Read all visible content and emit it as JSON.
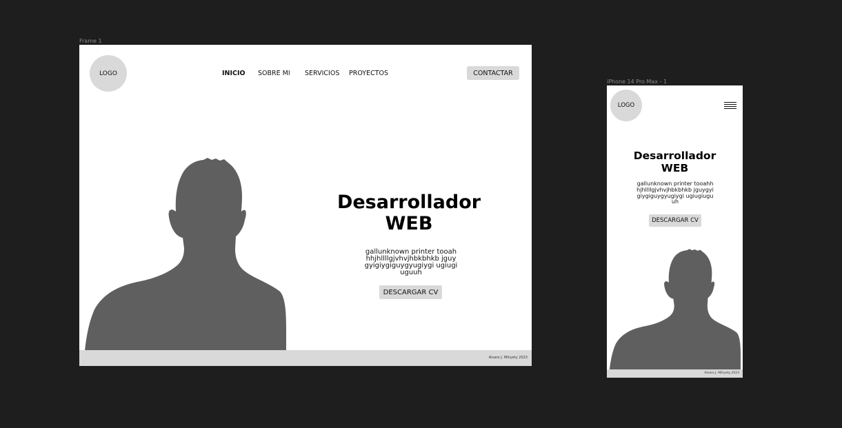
{
  "desktop": {
    "frame_label": "Frame 1",
    "logo": "LOGO",
    "nav": [
      {
        "label": "INICIO",
        "active": true
      },
      {
        "label": "SOBRE MI",
        "active": false
      },
      {
        "label": "SERVICIOS",
        "active": false
      },
      {
        "label": "PROYECTOS",
        "active": false
      }
    ],
    "contact_button": "CONTACTAR",
    "hero": {
      "title": "Desarrollador WEB",
      "description": "gallunknown printer tooahhhjhllllgjvhvjhbkbhkb jguygyigiygiguygyugiygi ugiugiuguuh",
      "cv_button": "DESCARGAR CV"
    },
    "footer": "Alvaro J. Mihyety 2023"
  },
  "mobile": {
    "frame_label": "iPhone 14 Pro Max - 1",
    "logo": "LOGO",
    "menu_icon": "hamburger-icon",
    "hero": {
      "title": "Desarrollador WEB",
      "description": "gallunknown printer tooahhhjhllllgjvhvjhbkbhkb jguygyigiygiguygyugiygi ugiugiuguuh",
      "cv_button": "DESCARGAR CV"
    },
    "footer": "Alvaro J. Mihyety 2023"
  },
  "colors": {
    "canvas": "#1e1e1e",
    "frame": "#ffffff",
    "placeholder": "#d9d9d9",
    "silhouette": "#5f5f5f"
  }
}
